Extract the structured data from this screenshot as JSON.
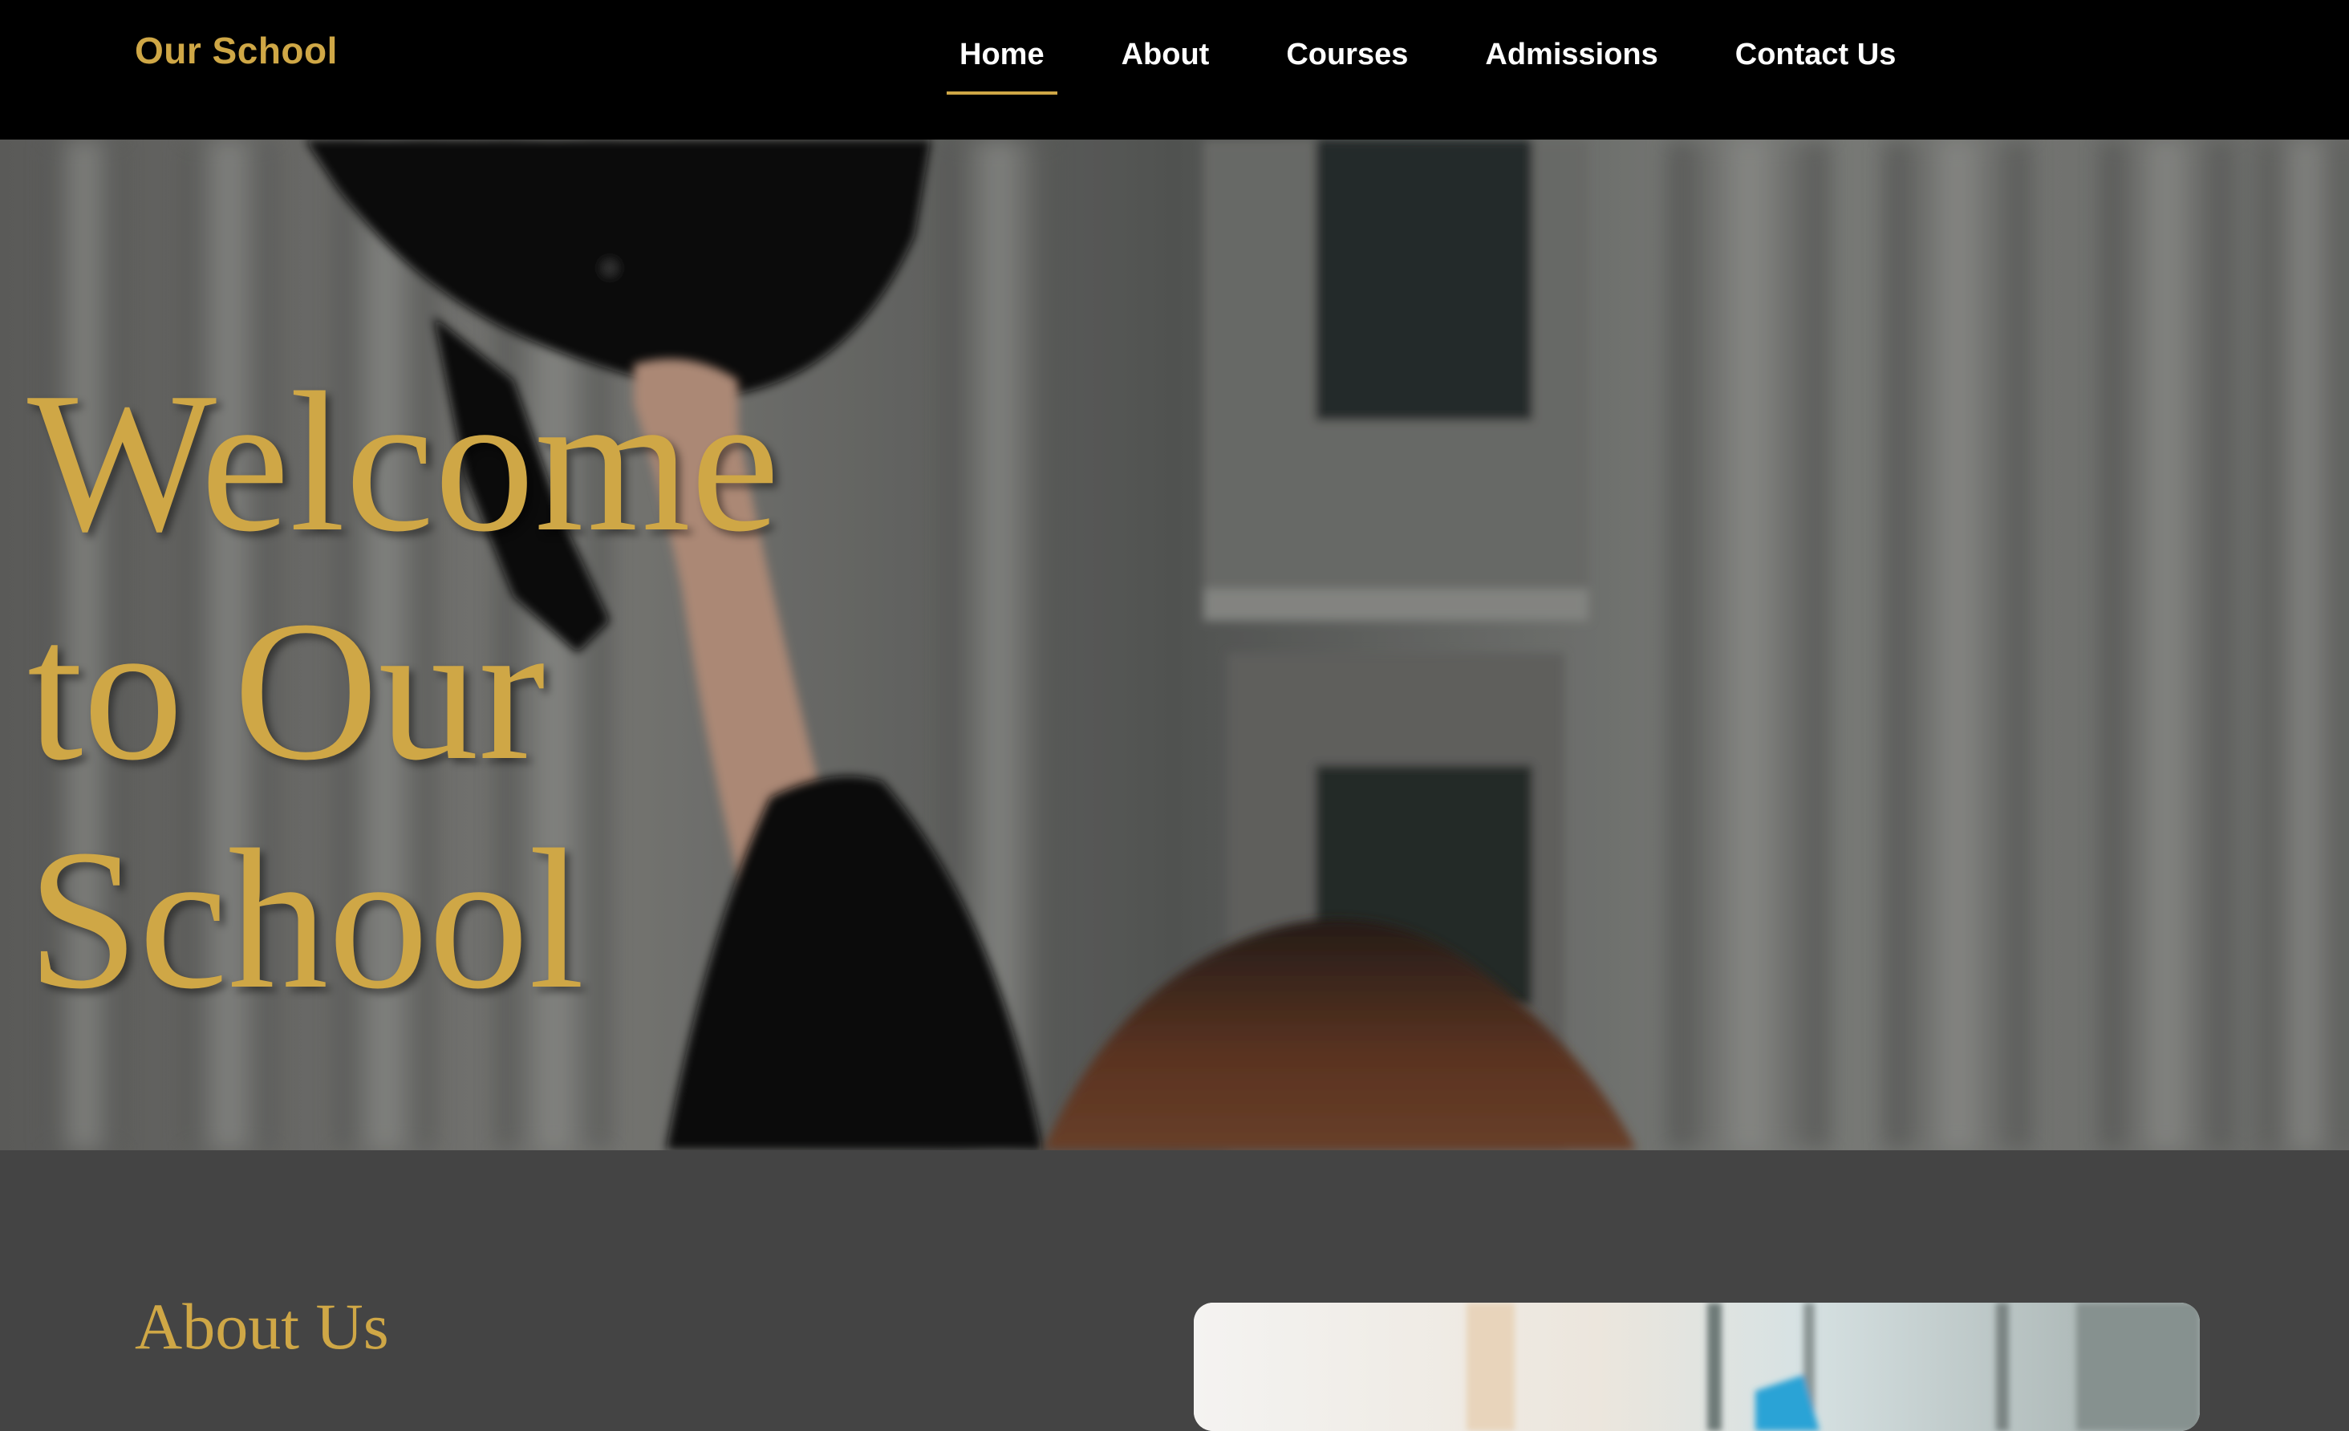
{
  "header": {
    "brand": "Our School",
    "nav": [
      {
        "label": "Home",
        "active": true
      },
      {
        "label": "About",
        "active": false
      },
      {
        "label": "Courses",
        "active": false
      },
      {
        "label": "Admissions",
        "active": false
      },
      {
        "label": "Contact Us",
        "active": false
      }
    ]
  },
  "hero": {
    "title_lines": [
      "Welcome",
      "to Our",
      "School"
    ],
    "image": "graduate-tossing-cap-photo"
  },
  "about": {
    "heading": "About Us",
    "image": "classroom-photo"
  },
  "colors": {
    "accent": "#cfa746",
    "header_bg": "#000000",
    "section_bg": "#444444",
    "nav_text": "#ffffff"
  }
}
